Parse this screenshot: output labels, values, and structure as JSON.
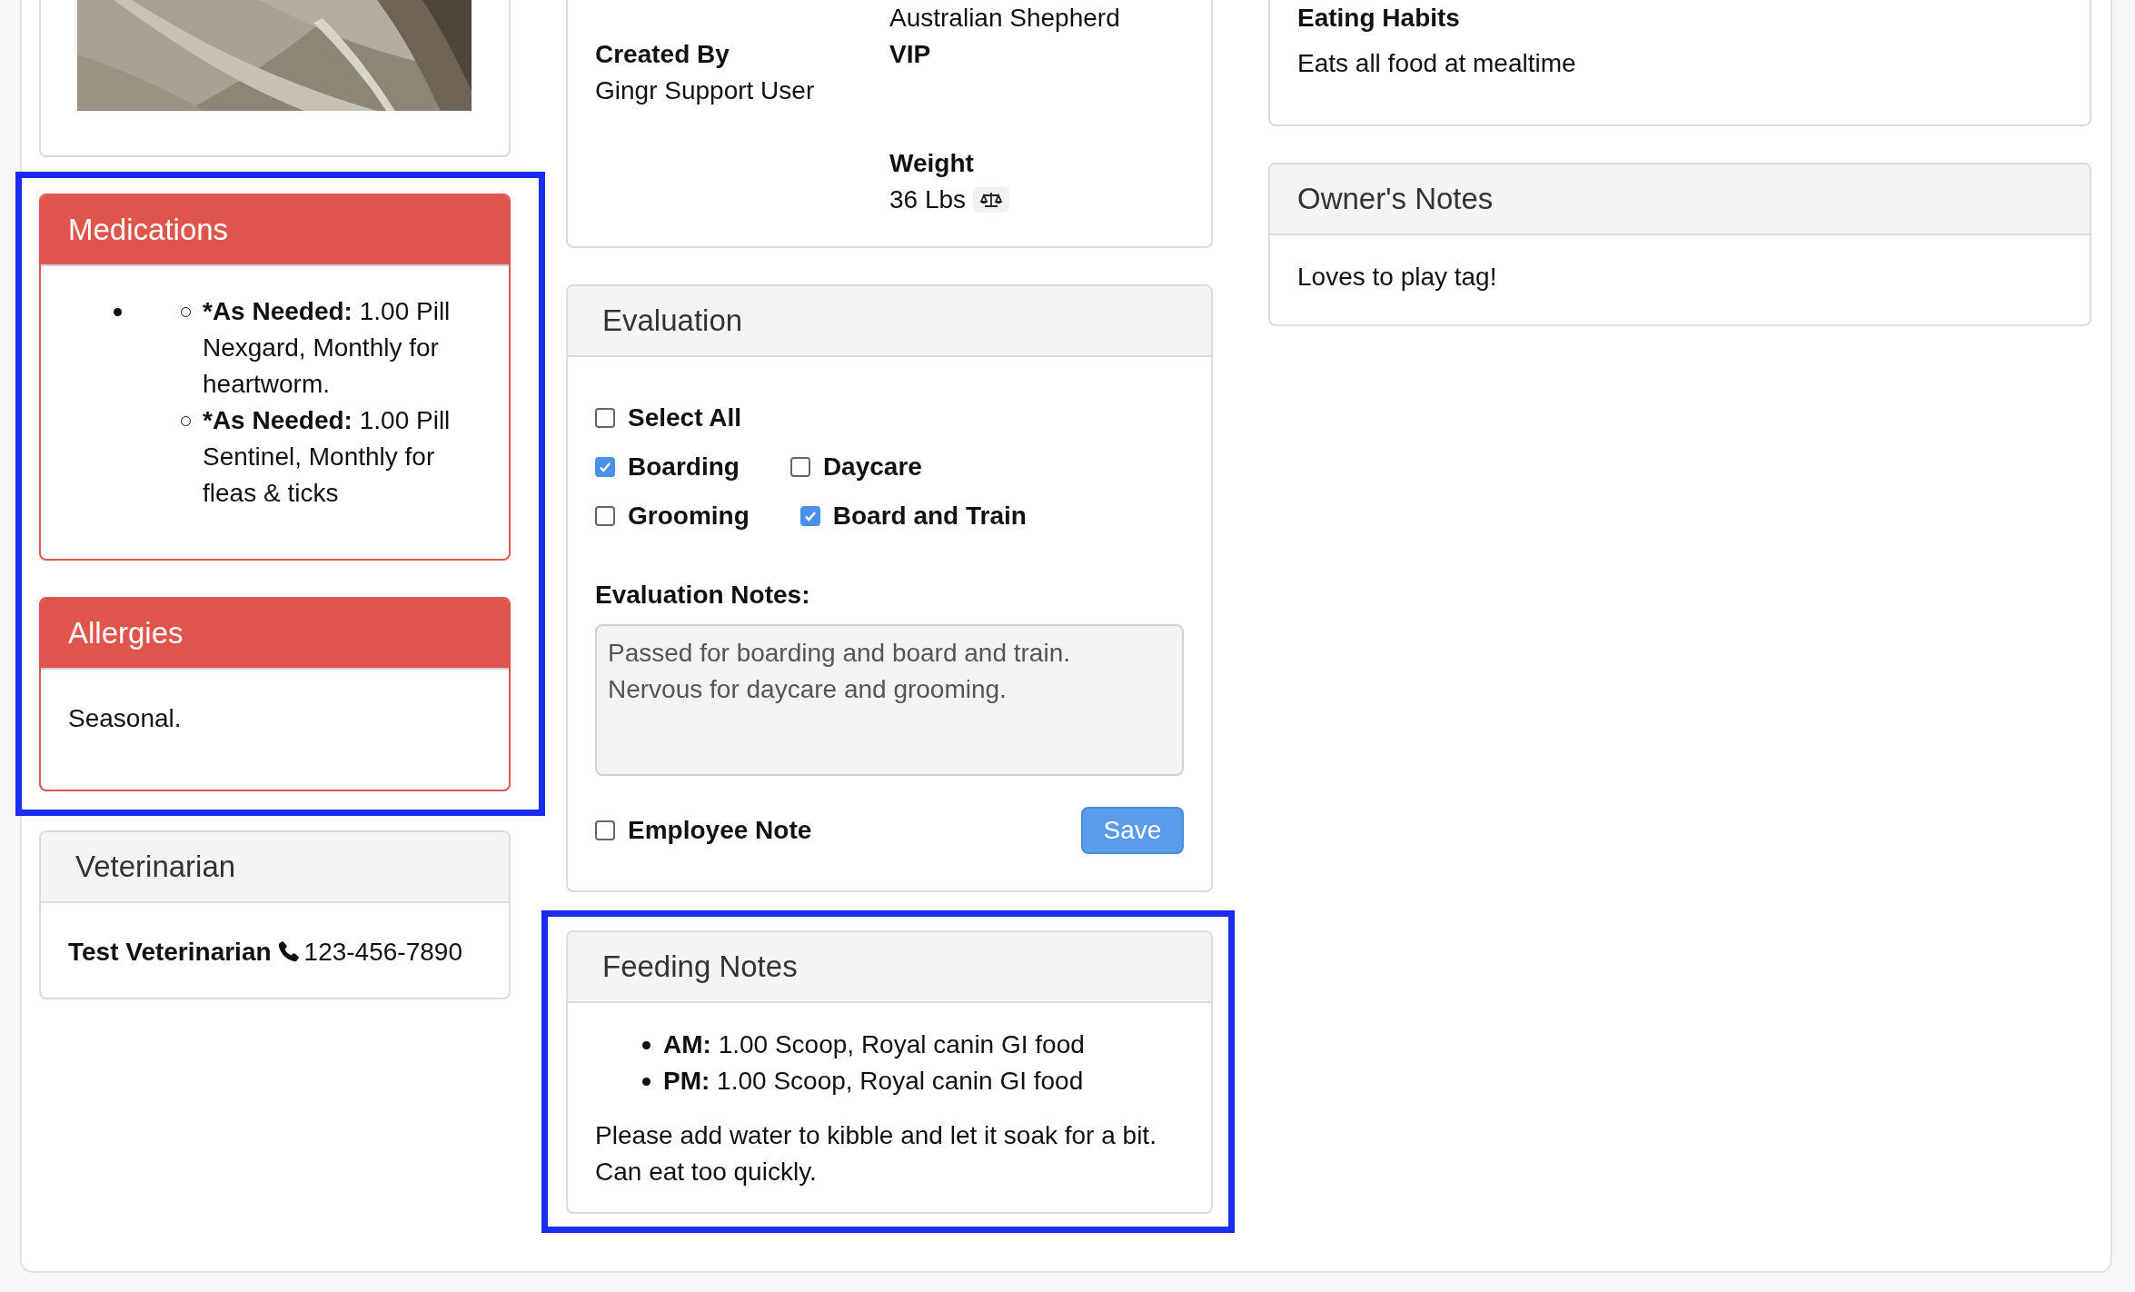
{
  "left_column": [
    {
      "highlighted": false
    },
    {
      "highlighted": true,
      "cards": [
        {
          "kind": "medications",
          "title": "Medications",
          "entries": [
            {
              "label": "*As Needed:",
              "text": "1.00 Pill Nexgard, Monthly for heartworm."
            },
            {
              "label": "*As Needed:",
              "text": "1.00 Pill Sentinel, Monthly for fleas & ticks"
            }
          ]
        },
        {
          "kind": "alert_text",
          "title": "Allergies",
          "text": "Seasonal."
        }
      ]
    },
    {
      "highlighted": false,
      "cards": [
        {
          "kind": "vet",
          "title": "Veterinarian",
          "name": "Test Veterinarian",
          "phone": "123-456-7890"
        }
      ]
    }
  ],
  "middle_column": [
    {
      "highlighted": false,
      "cards": [
        {
          "kind": "info",
          "fields_left": [
            {
              "label": "Created By",
              "value": "Gingr Support User"
            }
          ],
          "fields_right": [
            {
              "value": "Australian Shepherd"
            },
            {
              "label": "VIP"
            },
            {
              "label": "Weight",
              "value": "36 Lbs",
              "scale_button": true
            }
          ]
        }
      ]
    },
    {
      "highlighted": false,
      "cards": [
        {
          "kind": "evaluation",
          "title": "Evaluation",
          "select_all": {
            "label": "Select All",
            "checked": false
          },
          "service_rows": [
            {
              "items": [
                {
                  "label": "Boarding",
                  "checked": true
                },
                {
                  "label": "Daycare",
                  "checked": false
                }
              ]
            },
            {
              "items": [
                {
                  "label": "Grooming",
                  "checked": false
                },
                {
                  "label": "Board and Train",
                  "checked": true
                }
              ]
            }
          ],
          "notes_label": "Evaluation Notes:",
          "notes": "Passed for boarding and board and train. Nervous for daycare and grooming.",
          "employee_note": {
            "label": "Employee Note",
            "checked": false
          },
          "save": "Save"
        }
      ]
    },
    {
      "highlighted": true,
      "cards": [
        {
          "kind": "feeding",
          "title": "Feeding Notes",
          "entries": [
            {
              "label": "AM:",
              "text": "1.00 Scoop, Royal canin GI food"
            },
            {
              "label": "PM:",
              "text": "1.00 Scoop, Royal canin GI food"
            }
          ],
          "text": "Please add water to kibble and let it soak for a bit. Can eat too quickly."
        }
      ]
    }
  ],
  "right_column": [
    {
      "highlighted": false,
      "cards": [
        {
          "kind": "info_plain",
          "label": "Eating Habits",
          "value": "Eats all food at mealtime"
        }
      ]
    },
    {
      "highlighted": false,
      "cards": [
        {
          "kind": "text",
          "title": "Owner's Notes",
          "text": "Loves to play tag!"
        }
      ]
    }
  ]
}
